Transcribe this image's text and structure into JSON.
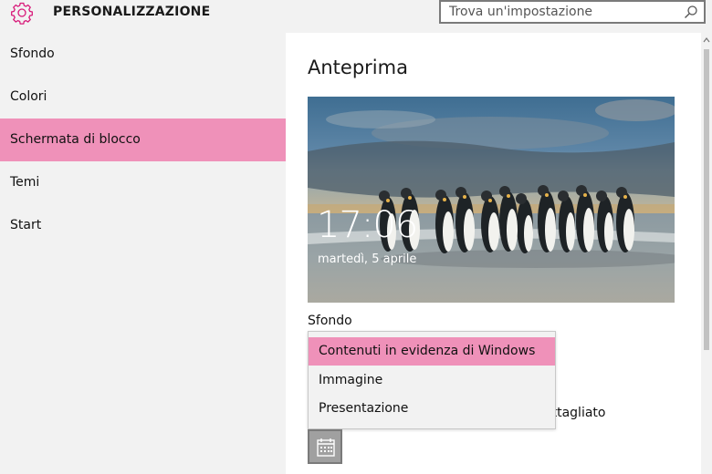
{
  "header": {
    "title": "PERSONALIZZAZIONE",
    "gear_icon": "gear-icon",
    "search_placeholder": "Trova un'impostazione",
    "search_icon": "search-icon"
  },
  "sidebar": {
    "items": [
      {
        "label": "Sfondo",
        "active": false
      },
      {
        "label": "Colori",
        "active": false
      },
      {
        "label": "Schermata di blocco",
        "active": true
      },
      {
        "label": "Temi",
        "active": false
      },
      {
        "label": "Start",
        "active": false
      }
    ]
  },
  "main": {
    "section_title": "Anteprima",
    "preview": {
      "time": "17:06",
      "date": "martedì, 5 aprile"
    },
    "background_label": "Sfondo",
    "dropdown": {
      "options": [
        "Contenuti in evidenza di Windows",
        "Immagine",
        "Presentazione"
      ],
      "selected_index": 0
    },
    "partially_hidden_text": "ettagliato",
    "calendar_icon": "calendar-icon"
  },
  "colors": {
    "accent": "#ef91b9",
    "gear_icon": "#d81b7a"
  }
}
